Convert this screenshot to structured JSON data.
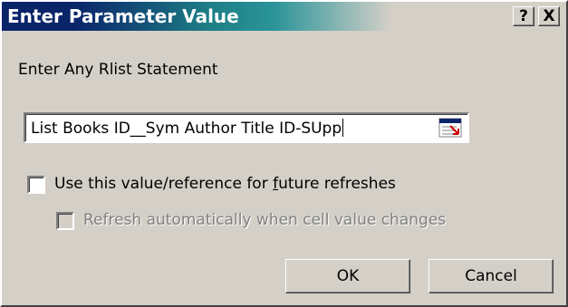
{
  "window": {
    "title": "Enter Parameter Value",
    "help_label": "?",
    "close_label": "X"
  },
  "prompt": "Enter Any Rlist Statement",
  "input": {
    "value": "List Books ID__Sym Author Title ID-SUpp",
    "icon": "range-select-icon"
  },
  "options": {
    "use_value": {
      "label_before": "Use this value/reference for ",
      "label_accel": "f",
      "label_after": "uture refreshes",
      "checked": false,
      "enabled": true
    },
    "auto_refresh": {
      "label": "Refresh automatically when cell value changes",
      "checked": false,
      "enabled": false
    }
  },
  "buttons": {
    "ok": "OK",
    "cancel": "Cancel"
  },
  "colors": {
    "title_start": "#0a246a",
    "title_mid": "#2a9499",
    "face": "#d4d0c8",
    "disabled_text": "#808080"
  }
}
